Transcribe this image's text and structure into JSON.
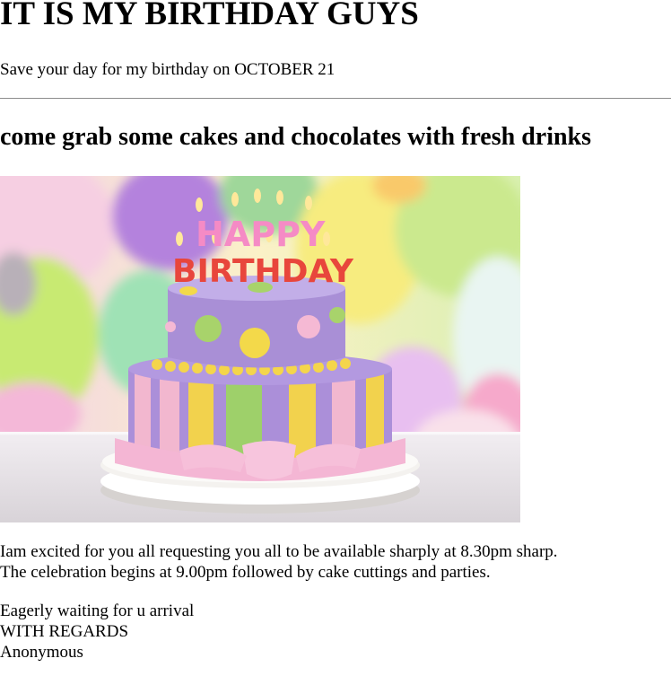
{
  "page": {
    "title": "IT IS MY BIRTHDAY GUYS",
    "subtitle": "Save your day for my birthday on OCTOBER 21",
    "heading": "come grab some cakes and chocolates with fresh drinks",
    "image": {
      "semantic": "birthday-cake-photo",
      "topper_line1": "HAPPY",
      "topper_line2": "BIRTHDAY",
      "colors": {
        "cake_purple": "#a98fd6",
        "ribbon_pink": "#f4b6d4",
        "accent_yellow": "#f3d94a",
        "accent_green": "#a8d36b"
      }
    },
    "paragraph1": {
      "line1": "Iam excited for you all requesting you all to be available sharply at 8.30pm sharp.",
      "line2": "The celebration begins at 9.00pm followed by cake cuttings and parties."
    },
    "paragraph2": {
      "line1": "Eagerly waiting for u arrival",
      "line2": "WITH REGARDS",
      "line3": "Anonymous"
    }
  }
}
